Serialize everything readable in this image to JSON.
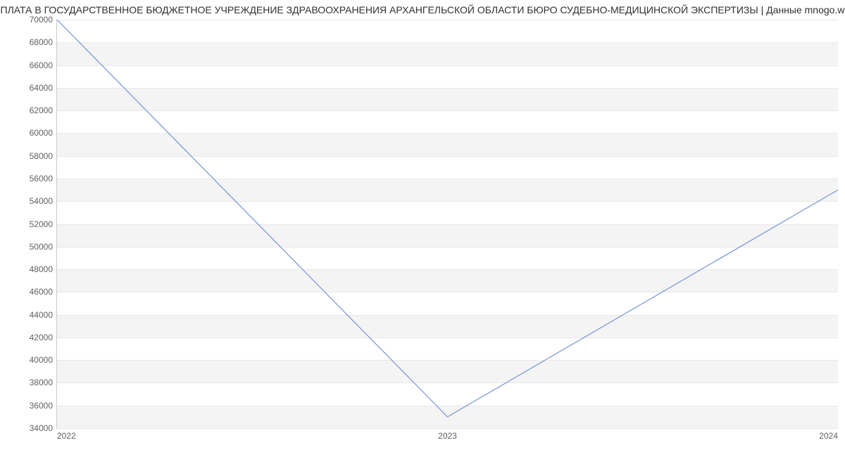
{
  "chart_data": {
    "type": "line",
    "title": "ПЛАТА В ГОСУДАРСТВЕННОЕ БЮДЖЕТНОЕ УЧРЕЖДЕНИЕ ЗДРАВООХРАНЕНИЯ АРХАНГЕЛЬСКОЙ ОБЛАСТИ БЮРО СУДЕБНО-МЕДИЦИНСКОЙ ЭКСПЕРТИЗЫ | Данные mnogo.w",
    "xlabel": "",
    "ylabel": "",
    "x": [
      2022,
      2023,
      2024
    ],
    "categories": [
      "2022",
      "2023",
      "2024"
    ],
    "series": [
      {
        "name": "value",
        "values": [
          70000,
          35000,
          55000
        ]
      }
    ],
    "ylim": [
      34000,
      70000
    ],
    "xlim": [
      2022,
      2024
    ],
    "yticks": [
      34000,
      36000,
      38000,
      40000,
      42000,
      44000,
      46000,
      48000,
      50000,
      52000,
      54000,
      56000,
      58000,
      60000,
      62000,
      64000,
      66000,
      68000,
      70000
    ],
    "grid": true
  }
}
